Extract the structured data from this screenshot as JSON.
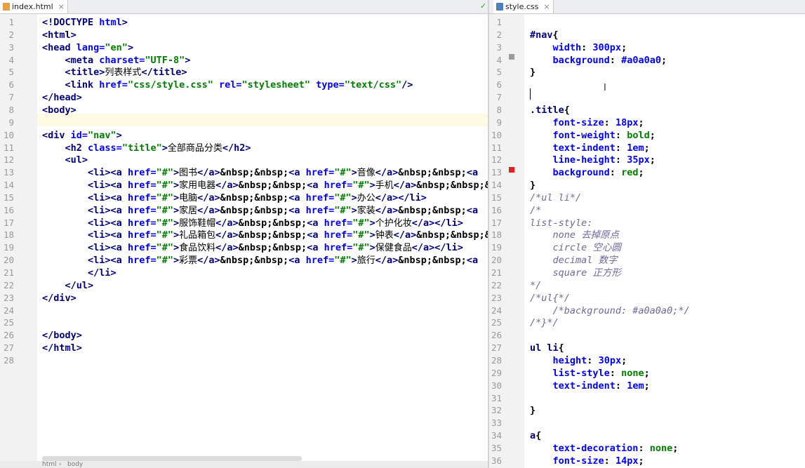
{
  "left_tab": {
    "label": "index.html",
    "close": "×"
  },
  "right_tab": {
    "label": "style.css",
    "close": "×"
  },
  "html_lines": [
    [
      [
        "t",
        "<!DOCTYPE "
      ],
      [
        "a",
        "html"
      ],
      [
        "t",
        ">"
      ]
    ],
    [
      [
        "t",
        "<html>"
      ]
    ],
    [
      [
        "t",
        "<head "
      ],
      [
        "a",
        "lang="
      ],
      [
        "s",
        "\"en\""
      ],
      [
        "t",
        ">"
      ]
    ],
    [
      [
        "p",
        "    "
      ],
      [
        "t",
        "<meta "
      ],
      [
        "a",
        "charset="
      ],
      [
        "s",
        "\"UTF-8\""
      ],
      [
        "t",
        ">"
      ]
    ],
    [
      [
        "p",
        "    "
      ],
      [
        "t",
        "<title>"
      ],
      [
        "zh",
        "列表样式"
      ],
      [
        "t",
        "</title>"
      ]
    ],
    [
      [
        "p",
        "    "
      ],
      [
        "t",
        "<link "
      ],
      [
        "a",
        "href="
      ],
      [
        "s",
        "\"css/style.css\""
      ],
      [
        "a",
        " rel="
      ],
      [
        "s",
        "\"stylesheet\""
      ],
      [
        "a",
        " type="
      ],
      [
        "s",
        "\"text/css\""
      ],
      [
        "t",
        "/>"
      ]
    ],
    [
      [
        "t",
        "</head>"
      ]
    ],
    [
      [
        "t",
        "<body>"
      ]
    ],
    [],
    [
      [
        "t",
        "<div "
      ],
      [
        "a",
        "id="
      ],
      [
        "s",
        "\"nav\""
      ],
      [
        "t",
        ">"
      ]
    ],
    [
      [
        "p",
        "    "
      ],
      [
        "t",
        "<h2 "
      ],
      [
        "a",
        "class="
      ],
      [
        "s",
        "\"title\""
      ],
      [
        "t",
        ">"
      ],
      [
        "zh",
        "全部商品分类"
      ],
      [
        "t",
        "</h2>"
      ]
    ],
    [
      [
        "p",
        "    "
      ],
      [
        "t",
        "<ul>"
      ]
    ],
    [
      [
        "p",
        "        "
      ],
      [
        "t",
        "<li><a "
      ],
      [
        "a",
        "href="
      ],
      [
        "s",
        "\"#\""
      ],
      [
        "t",
        ">"
      ],
      [
        "zh",
        "图书"
      ],
      [
        "t",
        "</a>"
      ],
      [
        "p",
        "&nbsp;&nbsp;"
      ],
      [
        "t",
        "<a "
      ],
      [
        "a",
        "href="
      ],
      [
        "s",
        "\"#\""
      ],
      [
        "t",
        ">"
      ],
      [
        "zh",
        "音像"
      ],
      [
        "t",
        "</a>"
      ],
      [
        "p",
        "&nbsp;&nbsp;"
      ],
      [
        "t",
        "<a"
      ]
    ],
    [
      [
        "p",
        "        "
      ],
      [
        "t",
        "<li><a "
      ],
      [
        "a",
        "href="
      ],
      [
        "s",
        "\"#\""
      ],
      [
        "t",
        ">"
      ],
      [
        "zh",
        "家用电器"
      ],
      [
        "t",
        "</a>"
      ],
      [
        "p",
        "&nbsp;&nbsp;"
      ],
      [
        "t",
        "<a "
      ],
      [
        "a",
        "href="
      ],
      [
        "s",
        "\"#\""
      ],
      [
        "t",
        ">"
      ],
      [
        "zh",
        "手机"
      ],
      [
        "t",
        "</a>"
      ],
      [
        "p",
        "&nbsp;&nbsp;&nbsp;"
      ]
    ],
    [
      [
        "p",
        "        "
      ],
      [
        "t",
        "<li><a "
      ],
      [
        "a",
        "href="
      ],
      [
        "s",
        "\"#\""
      ],
      [
        "t",
        ">"
      ],
      [
        "zh",
        "电脑"
      ],
      [
        "t",
        "</a>"
      ],
      [
        "p",
        "&nbsp;&nbsp;"
      ],
      [
        "t",
        "<a "
      ],
      [
        "a",
        "href="
      ],
      [
        "s",
        "\"#\""
      ],
      [
        "t",
        ">"
      ],
      [
        "zh",
        "办公"
      ],
      [
        "t",
        "</a></li>"
      ]
    ],
    [
      [
        "p",
        "        "
      ],
      [
        "t",
        "<li><a "
      ],
      [
        "a",
        "href="
      ],
      [
        "s",
        "\"#\""
      ],
      [
        "t",
        ">"
      ],
      [
        "zh",
        "家居"
      ],
      [
        "t",
        "</a>"
      ],
      [
        "p",
        "&nbsp;&nbsp;"
      ],
      [
        "t",
        "<a "
      ],
      [
        "a",
        "href="
      ],
      [
        "s",
        "\"#\""
      ],
      [
        "t",
        ">"
      ],
      [
        "zh",
        "家装"
      ],
      [
        "t",
        "</a>"
      ],
      [
        "p",
        "&nbsp;&nbsp;"
      ],
      [
        "t",
        "<a"
      ]
    ],
    [
      [
        "p",
        "        "
      ],
      [
        "t",
        "<li><a "
      ],
      [
        "a",
        "href="
      ],
      [
        "s",
        "\"#\""
      ],
      [
        "t",
        ">"
      ],
      [
        "zh",
        "服饰鞋帽"
      ],
      [
        "t",
        "</a>"
      ],
      [
        "p",
        "&nbsp;&nbsp;"
      ],
      [
        "t",
        "<a "
      ],
      [
        "a",
        "href="
      ],
      [
        "s",
        "\"#\""
      ],
      [
        "t",
        ">"
      ],
      [
        "zh",
        "个护化妆"
      ],
      [
        "t",
        "</a></li>"
      ]
    ],
    [
      [
        "p",
        "        "
      ],
      [
        "t",
        "<li><a "
      ],
      [
        "a",
        "href="
      ],
      [
        "s",
        "\"#\""
      ],
      [
        "t",
        ">"
      ],
      [
        "zh",
        "礼品箱包"
      ],
      [
        "t",
        "</a>"
      ],
      [
        "p",
        "&nbsp;&nbsp;"
      ],
      [
        "t",
        "<a "
      ],
      [
        "a",
        "href="
      ],
      [
        "s",
        "\"#\""
      ],
      [
        "t",
        ">"
      ],
      [
        "zh",
        "钟表"
      ],
      [
        "t",
        "</a>"
      ],
      [
        "p",
        "&nbsp;&nbsp;&nbsp;"
      ]
    ],
    [
      [
        "p",
        "        "
      ],
      [
        "t",
        "<li><a "
      ],
      [
        "a",
        "href="
      ],
      [
        "s",
        "\"#\""
      ],
      [
        "t",
        ">"
      ],
      [
        "zh",
        "食品饮料"
      ],
      [
        "t",
        "</a>"
      ],
      [
        "p",
        "&nbsp;&nbsp;"
      ],
      [
        "t",
        "<a "
      ],
      [
        "a",
        "href="
      ],
      [
        "s",
        "\"#\""
      ],
      [
        "t",
        ">"
      ],
      [
        "zh",
        "保健食品"
      ],
      [
        "t",
        "</a></li>"
      ]
    ],
    [
      [
        "p",
        "        "
      ],
      [
        "t",
        "<li><a "
      ],
      [
        "a",
        "href="
      ],
      [
        "s",
        "\"#\""
      ],
      [
        "t",
        ">"
      ],
      [
        "zh",
        "彩票"
      ],
      [
        "t",
        "</a>"
      ],
      [
        "p",
        "&nbsp;&nbsp;"
      ],
      [
        "t",
        "<a "
      ],
      [
        "a",
        "href="
      ],
      [
        "s",
        "\"#\""
      ],
      [
        "t",
        ">"
      ],
      [
        "zh",
        "旅行"
      ],
      [
        "t",
        "</a>"
      ],
      [
        "p",
        "&nbsp;&nbsp;"
      ],
      [
        "t",
        "<a"
      ]
    ],
    [
      [
        "p",
        "        "
      ],
      [
        "t",
        "</li>"
      ]
    ],
    [
      [
        "p",
        "    "
      ],
      [
        "t",
        "</ul>"
      ]
    ],
    [
      [
        "t",
        "</div>"
      ]
    ],
    [],
    [],
    [
      [
        "t",
        "</body>"
      ]
    ],
    [
      [
        "t",
        "</html>"
      ]
    ],
    []
  ],
  "css_lines": [
    [],
    [
      [
        "sel",
        "#nav"
      ],
      [
        "p",
        "{"
      ]
    ],
    [
      [
        "p",
        "    "
      ],
      [
        "prop",
        "width"
      ],
      [
        "p",
        ": "
      ],
      [
        "num",
        "300px"
      ],
      [
        "p",
        ";"
      ]
    ],
    [
      [
        "p",
        "    "
      ],
      [
        "prop",
        "background"
      ],
      [
        "p",
        ": "
      ],
      [
        "num",
        "#a0a0a0"
      ],
      [
        "p",
        ";"
      ]
    ],
    [
      [
        "p",
        "}"
      ]
    ],
    [],
    [],
    [
      [
        "sel",
        ".title"
      ],
      [
        "p",
        "{"
      ]
    ],
    [
      [
        "p",
        "    "
      ],
      [
        "prop",
        "font-size"
      ],
      [
        "p",
        ": "
      ],
      [
        "num",
        "18px"
      ],
      [
        "p",
        ";"
      ]
    ],
    [
      [
        "p",
        "    "
      ],
      [
        "prop",
        "font-weight"
      ],
      [
        "p",
        ": "
      ],
      [
        "val",
        "bold"
      ],
      [
        "p",
        ";"
      ]
    ],
    [
      [
        "p",
        "    "
      ],
      [
        "prop",
        "text-indent"
      ],
      [
        "p",
        ": "
      ],
      [
        "num",
        "1em"
      ],
      [
        "p",
        ";"
      ]
    ],
    [
      [
        "p",
        "    "
      ],
      [
        "prop",
        "line-height"
      ],
      [
        "p",
        ": "
      ],
      [
        "num",
        "35px"
      ],
      [
        "p",
        ";"
      ]
    ],
    [
      [
        "p",
        "    "
      ],
      [
        "prop",
        "background"
      ],
      [
        "p",
        ": "
      ],
      [
        "val",
        "red"
      ],
      [
        "p",
        ";"
      ]
    ],
    [
      [
        "p",
        "}"
      ]
    ],
    [
      [
        "cm",
        "/*ul li*/"
      ]
    ],
    [
      [
        "cm",
        "/*"
      ]
    ],
    [
      [
        "cm",
        "list-style:"
      ]
    ],
    [
      [
        "cm",
        "    none 去掉原点"
      ]
    ],
    [
      [
        "cm",
        "    circle 空心圆"
      ]
    ],
    [
      [
        "cm",
        "    decimal 数字"
      ]
    ],
    [
      [
        "cm",
        "    square 正方形"
      ]
    ],
    [
      [
        "cm",
        "*/"
      ]
    ],
    [
      [
        "cm",
        "/*ul{*/"
      ]
    ],
    [
      [
        "cm",
        "    /*background: #a0a0a0;*/"
      ]
    ],
    [
      [
        "cm",
        "/*}*/"
      ]
    ],
    [],
    [
      [
        "sel",
        "ul li"
      ],
      [
        "p",
        "{"
      ]
    ],
    [
      [
        "p",
        "    "
      ],
      [
        "prop",
        "height"
      ],
      [
        "p",
        ": "
      ],
      [
        "num",
        "30px"
      ],
      [
        "p",
        ";"
      ]
    ],
    [
      [
        "p",
        "    "
      ],
      [
        "prop",
        "list-style"
      ],
      [
        "p",
        ": "
      ],
      [
        "val",
        "none"
      ],
      [
        "p",
        ";"
      ]
    ],
    [
      [
        "p",
        "    "
      ],
      [
        "prop",
        "text-indent"
      ],
      [
        "p",
        ": "
      ],
      [
        "num",
        "1em"
      ],
      [
        "p",
        ";"
      ]
    ],
    [],
    [
      [
        "p",
        "}"
      ]
    ],
    [],
    [
      [
        "sel",
        "a"
      ],
      [
        "p",
        "{"
      ]
    ],
    [
      [
        "p",
        "    "
      ],
      [
        "prop",
        "text-decoration"
      ],
      [
        "p",
        ": "
      ],
      [
        "val",
        "none"
      ],
      [
        "p",
        ";"
      ]
    ],
    [
      [
        "p",
        "    "
      ],
      [
        "prop",
        "font-size"
      ],
      [
        "p",
        ": "
      ],
      [
        "num",
        "14px"
      ],
      [
        "p",
        ";"
      ]
    ]
  ],
  "breadcrumb": [
    "html",
    "body"
  ],
  "colors": {
    "red_marker": "#e02020",
    "gray_marker": "#9a9a9a",
    "current_line": "#fffae3"
  }
}
